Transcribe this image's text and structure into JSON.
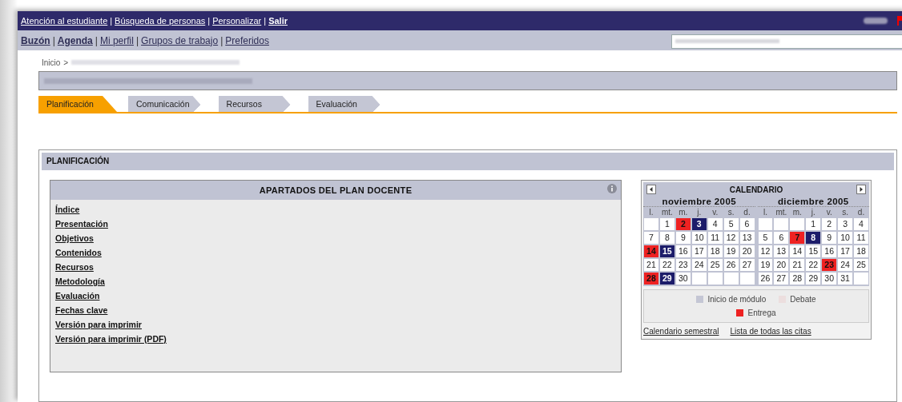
{
  "top_links": [
    {
      "label": "Atención al estudiante",
      "bold": false
    },
    {
      "separator": "|",
      "label": "Búsqueda de personas",
      "bold": false
    },
    {
      "separator": "|",
      "label": "Personalizar",
      "bold": false
    },
    {
      "separator": "|",
      "label": "Salir",
      "bold": true
    }
  ],
  "second_links": [
    {
      "label": "Buzón",
      "bold": true
    },
    {
      "separator": "|",
      "label": "Agenda",
      "bold": true
    },
    {
      "separator": "|",
      "label": "Mi perfil",
      "bold": false
    },
    {
      "separator": "|",
      "label": "Grupos de trabajo",
      "bold": false
    },
    {
      "separator": "|",
      "label": "Preferidos",
      "bold": false
    }
  ],
  "breadcrumb": {
    "home": "Inicio",
    "separator": ">"
  },
  "tabs": [
    {
      "label": "Planificación",
      "selected": true
    },
    {
      "label": "Comunicación",
      "selected": false
    },
    {
      "label": "Recursos",
      "selected": false
    },
    {
      "label": "Evaluación",
      "selected": false
    }
  ],
  "panel": {
    "title": "PLANIFICACIÓN"
  },
  "plan": {
    "title": "APARTADOS DEL PLAN DOCENTE",
    "items": [
      "Índice",
      "Presentación",
      "Objetivos",
      "Contenidos",
      "Recursos",
      "Metodología",
      "Evaluación",
      "Fechas clave",
      "Versión para imprimir",
      "Versión para imprimir (PDF)"
    ]
  },
  "calendar": {
    "title": "CALENDARIO",
    "months": [
      {
        "name": "noviembre 2005",
        "weekdays": [
          "l.",
          "mt.",
          "m.",
          "j.",
          "v.",
          "s.",
          "d."
        ],
        "weeks": [
          [
            {
              "kind": "blank"
            },
            {
              "day": "1",
              "kind": "plain"
            },
            {
              "day": "2",
              "kind": "delivery"
            },
            {
              "day": "3",
              "kind": "module_start"
            },
            {
              "day": "4",
              "kind": "plain"
            },
            {
              "day": "5",
              "kind": "plain"
            },
            {
              "day": "6",
              "kind": "plain"
            }
          ],
          [
            {
              "day": "7",
              "kind": "plain"
            },
            {
              "day": "8",
              "kind": "plain"
            },
            {
              "day": "9",
              "kind": "plain"
            },
            {
              "day": "10",
              "kind": "plain"
            },
            {
              "day": "11",
              "kind": "plain"
            },
            {
              "day": "12",
              "kind": "plain"
            },
            {
              "day": "13",
              "kind": "plain"
            }
          ],
          [
            {
              "day": "14",
              "kind": "delivery"
            },
            {
              "day": "15",
              "kind": "module_start"
            },
            {
              "day": "16",
              "kind": "plain"
            },
            {
              "day": "17",
              "kind": "plain"
            },
            {
              "day": "18",
              "kind": "plain"
            },
            {
              "day": "19",
              "kind": "plain"
            },
            {
              "day": "20",
              "kind": "plain"
            }
          ],
          [
            {
              "day": "21",
              "kind": "plain"
            },
            {
              "day": "22",
              "kind": "plain"
            },
            {
              "day": "23",
              "kind": "plain"
            },
            {
              "day": "24",
              "kind": "plain"
            },
            {
              "day": "25",
              "kind": "plain"
            },
            {
              "day": "26",
              "kind": "plain"
            },
            {
              "day": "27",
              "kind": "plain"
            }
          ],
          [
            {
              "day": "28",
              "kind": "delivery"
            },
            {
              "day": "29",
              "kind": "module_start"
            },
            {
              "day": "30",
              "kind": "plain"
            },
            {
              "kind": "blank"
            },
            {
              "kind": "blank"
            },
            {
              "kind": "blank"
            },
            {
              "kind": "blank"
            }
          ]
        ]
      },
      {
        "name": "diciembre 2005",
        "weekdays": [
          "l.",
          "mt.",
          "m.",
          "j.",
          "v.",
          "s.",
          "d."
        ],
        "weeks": [
          [
            {
              "kind": "blank"
            },
            {
              "kind": "blank"
            },
            {
              "kind": "blank"
            },
            {
              "day": "1",
              "kind": "plain"
            },
            {
              "day": "2",
              "kind": "plain"
            },
            {
              "day": "3",
              "kind": "plain"
            },
            {
              "day": "4",
              "kind": "plain"
            }
          ],
          [
            {
              "day": "5",
              "kind": "plain"
            },
            {
              "day": "6",
              "kind": "plain"
            },
            {
              "day": "7",
              "kind": "delivery"
            },
            {
              "day": "8",
              "kind": "module_start"
            },
            {
              "day": "9",
              "kind": "plain"
            },
            {
              "day": "10",
              "kind": "plain"
            },
            {
              "day": "11",
              "kind": "plain"
            }
          ],
          [
            {
              "day": "12",
              "kind": "plain"
            },
            {
              "day": "13",
              "kind": "plain"
            },
            {
              "day": "14",
              "kind": "plain"
            },
            {
              "day": "15",
              "kind": "plain"
            },
            {
              "day": "16",
              "kind": "plain"
            },
            {
              "day": "17",
              "kind": "plain"
            },
            {
              "day": "18",
              "kind": "plain"
            }
          ],
          [
            {
              "day": "19",
              "kind": "plain"
            },
            {
              "day": "20",
              "kind": "plain"
            },
            {
              "day": "21",
              "kind": "plain"
            },
            {
              "day": "22",
              "kind": "plain"
            },
            {
              "day": "23",
              "kind": "delivery"
            },
            {
              "day": "24",
              "kind": "plain"
            },
            {
              "day": "25",
              "kind": "plain"
            }
          ],
          [
            {
              "day": "26",
              "kind": "plain"
            },
            {
              "day": "27",
              "kind": "plain"
            },
            {
              "day": "28",
              "kind": "plain"
            },
            {
              "day": "29",
              "kind": "plain"
            },
            {
              "day": "30",
              "kind": "plain"
            },
            {
              "day": "31",
              "kind": "plain"
            },
            {
              "kind": "blank"
            }
          ]
        ]
      }
    ],
    "legend": [
      {
        "label": "Inicio de módulo",
        "color": "#c4c6d4"
      },
      {
        "label": "Debate",
        "color": "#ecdede"
      },
      {
        "label": "Entrega",
        "color": "#ee2222"
      }
    ],
    "links": [
      "Calendario semestral",
      "Lista de todas las citas"
    ]
  }
}
